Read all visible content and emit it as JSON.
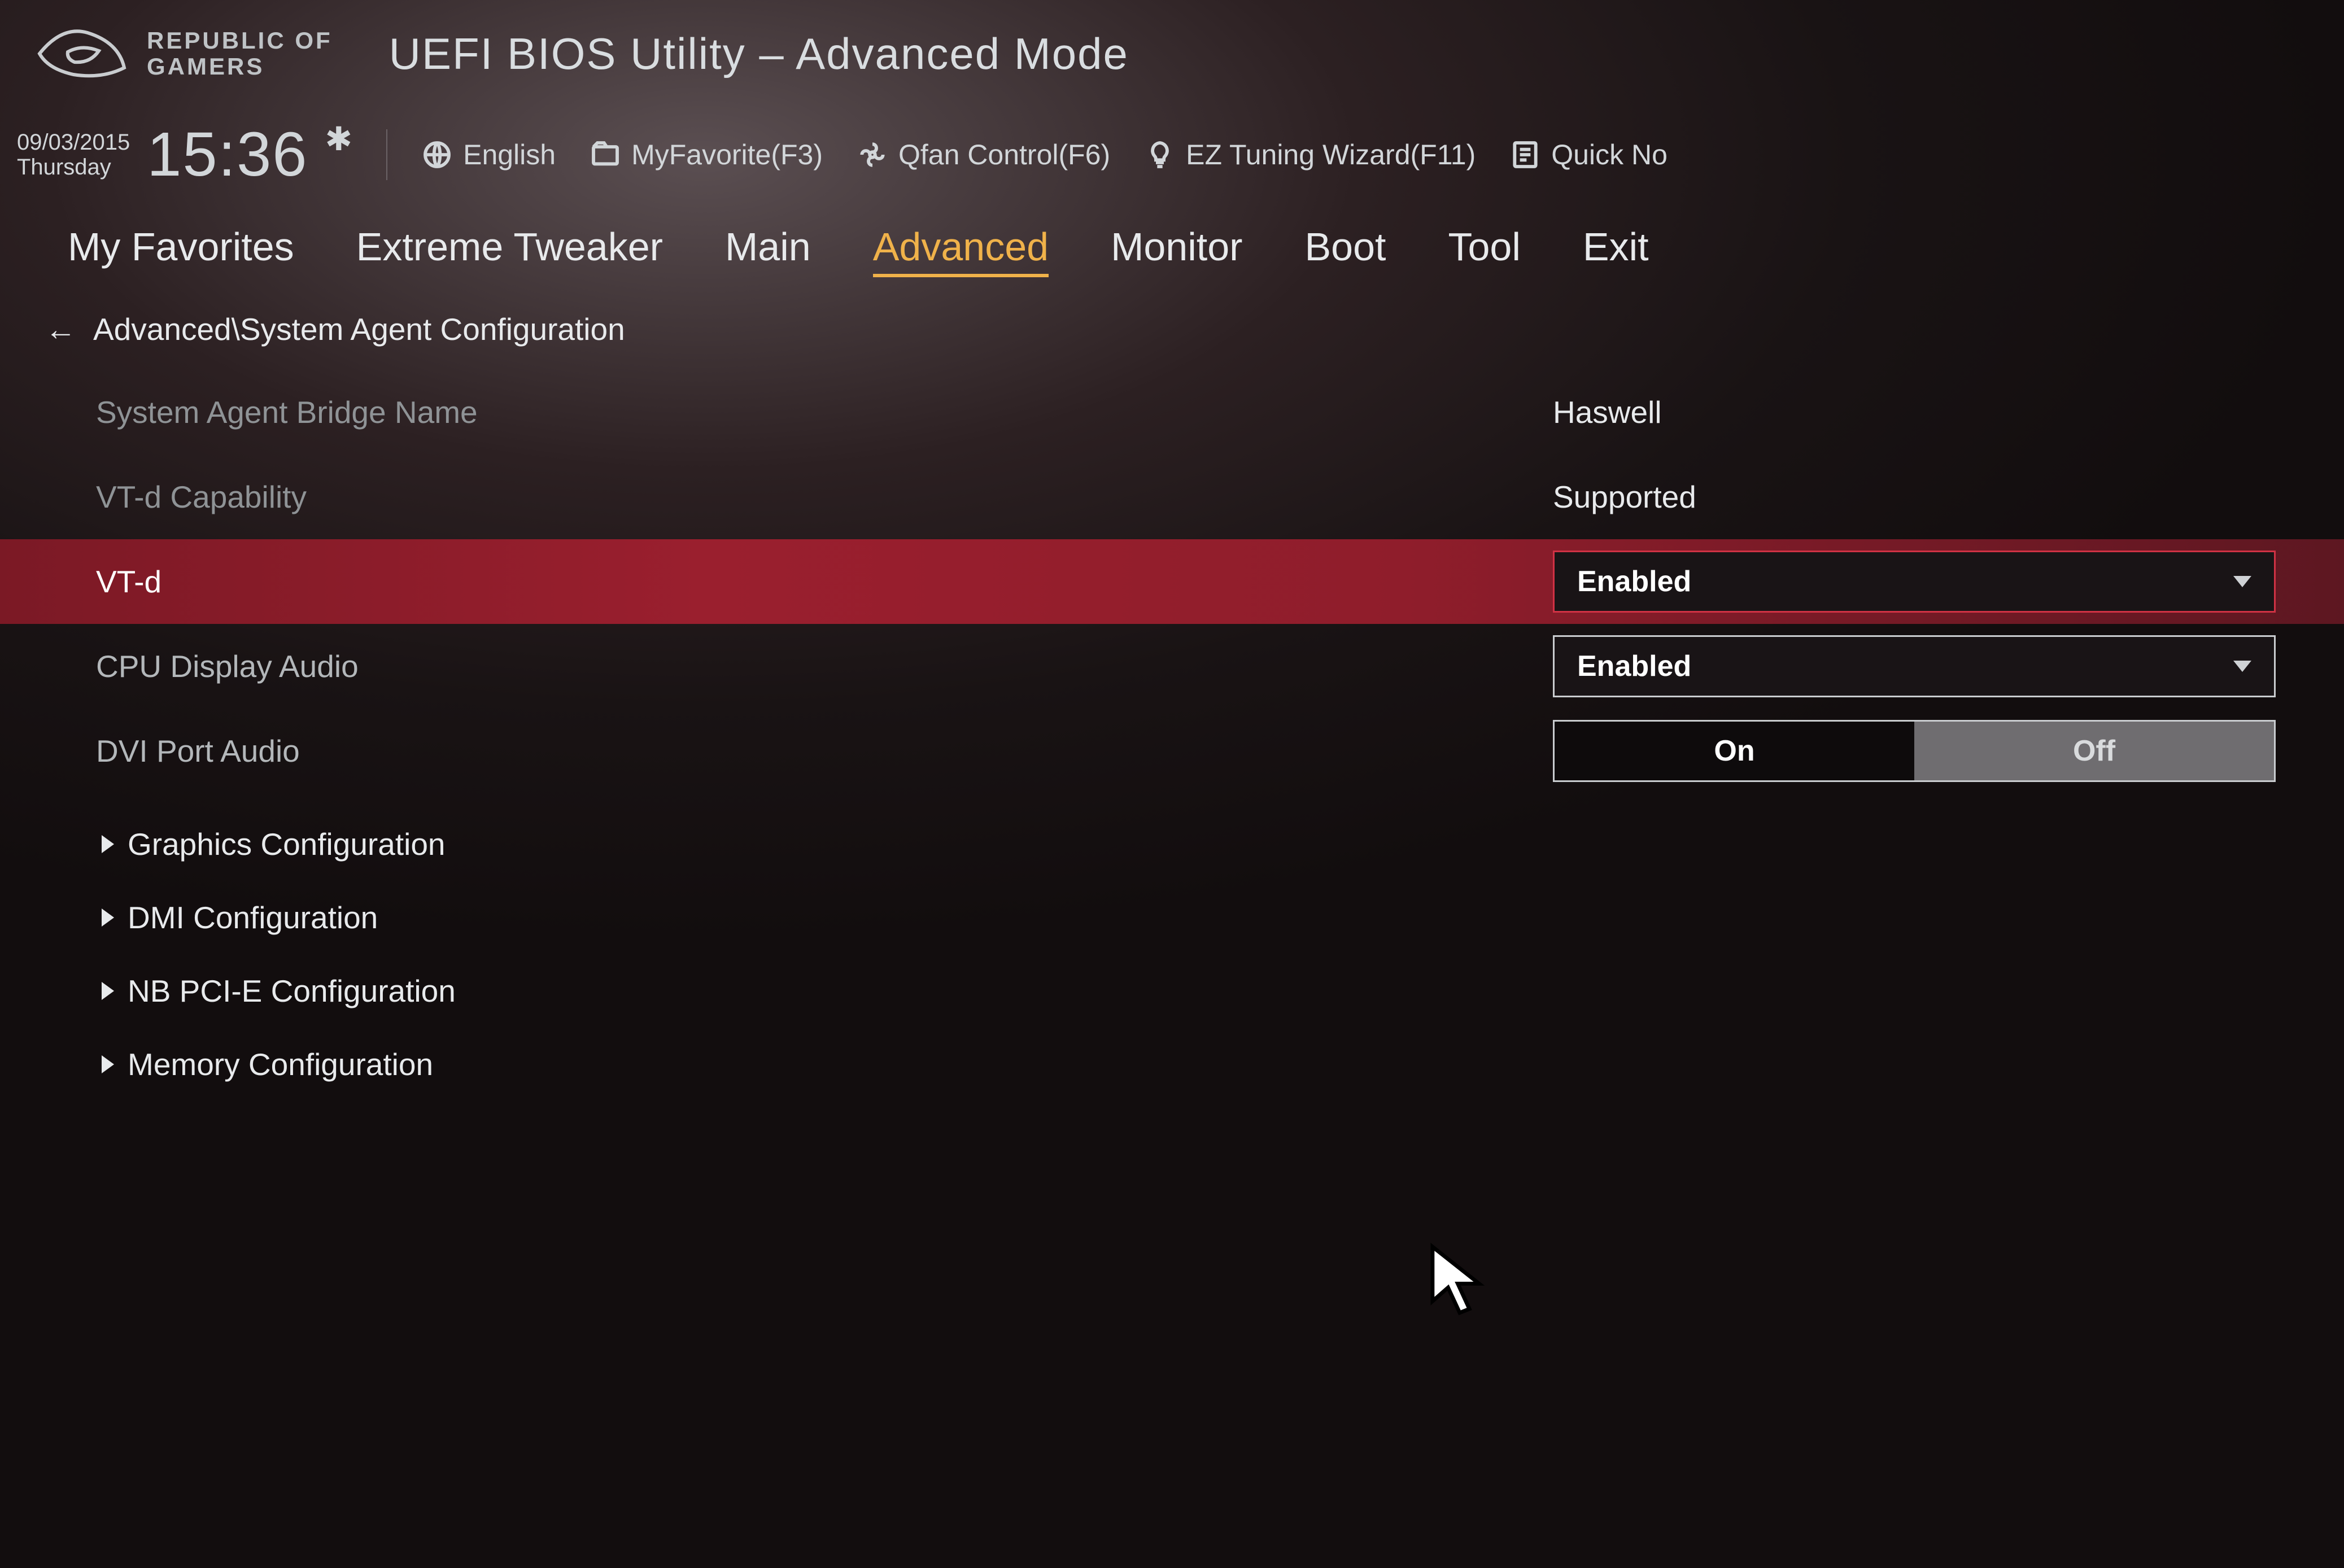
{
  "brand": {
    "line1": "REPUBLIC OF",
    "line2": "GAMERS"
  },
  "title": "UEFI BIOS Utility – Advanced Mode",
  "datetime": {
    "date": "09/03/2015",
    "day": "Thursday",
    "time": "15:36"
  },
  "toolbar": {
    "language": "English",
    "favorite": "MyFavorite(F3)",
    "qfan": "Qfan Control(F6)",
    "eztune": "EZ Tuning Wizard(F11)",
    "quicknote": "Quick No"
  },
  "tabs": [
    "My Favorites",
    "Extreme Tweaker",
    "Main",
    "Advanced",
    "Monitor",
    "Boot",
    "Tool",
    "Exit"
  ],
  "active_tab": "Advanced",
  "breadcrumb": "Advanced\\System Agent Configuration",
  "settings": {
    "bridge": {
      "label": "System Agent Bridge Name",
      "value": "Haswell"
    },
    "vtd_cap": {
      "label": "VT-d Capability",
      "value": "Supported"
    },
    "vtd": {
      "label": "VT-d",
      "value": "Enabled"
    },
    "cpu_disp": {
      "label": "CPU Display Audio",
      "value": "Enabled"
    },
    "dvi_aud": {
      "label": "DVI Port Audio",
      "on": "On",
      "off": "Off",
      "value": "Off"
    }
  },
  "submenus": [
    "Graphics Configuration",
    "DMI Configuration",
    "NB PCI-E Configuration",
    "Memory Configuration"
  ]
}
